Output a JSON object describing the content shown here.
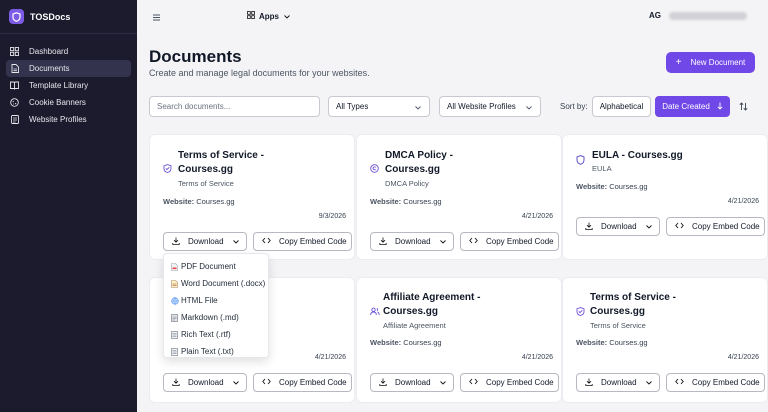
{
  "app": {
    "name": "TOSDocs"
  },
  "sidebar": {
    "items": [
      {
        "label": "Dashboard",
        "icon": "grid-icon"
      },
      {
        "label": "Documents",
        "icon": "file-icon",
        "active": true
      },
      {
        "label": "Template Library",
        "icon": "book-icon"
      },
      {
        "label": "Cookie Banners",
        "icon": "cookie-icon"
      },
      {
        "label": "Website Profiles",
        "icon": "website-icon"
      }
    ]
  },
  "topbar": {
    "apps_label": "Apps",
    "user_initials": "AG"
  },
  "page": {
    "title": "Documents",
    "subtitle": "Create and manage legal documents for your websites.",
    "new_button": "New Document"
  },
  "filters": {
    "search_placeholder": "Search documents...",
    "type_select": "All Types",
    "profile_select": "All Website Profiles",
    "sort_label": "Sort by:",
    "sort_alpha": "Alphabetical",
    "sort_date": "Date Created"
  },
  "labels": {
    "website": "Website:",
    "download": "Download",
    "copy_embed": "Copy Embed Code"
  },
  "cards": [
    {
      "title": "Terms of Service - Courses.gg",
      "type": "Terms of Service",
      "website": "Courses.gg",
      "date": "9/3/2026",
      "icon": "shield-check-icon"
    },
    {
      "title": "DMCA Policy - Courses.gg",
      "type": "DMCA Policy",
      "website": "Courses.gg",
      "date": "4/21/2026",
      "icon": "copyright-icon"
    },
    {
      "title": "EULA - Courses.gg",
      "type": "EULA",
      "website": "Courses.gg",
      "date": "4/21/2026",
      "icon": "shield-icon"
    },
    {
      "title": "",
      "type": "",
      "website": "",
      "date": "4/21/2026",
      "icon": ""
    },
    {
      "title": "Affiliate Agreement - Courses.gg",
      "type": "Affiliate Agreement",
      "website": "Courses.gg",
      "date": "4/21/2026",
      "icon": "users-icon"
    },
    {
      "title": "Terms of Service - Courses.gg",
      "type": "Terms of Service",
      "website": "Courses.gg",
      "date": "4/21/2026",
      "icon": "shield-check-icon"
    }
  ],
  "download_menu": {
    "items": [
      {
        "label": "PDF Document",
        "icon": "pdf-file-icon"
      },
      {
        "label": "Word Document (.docx)",
        "icon": "word-file-icon"
      },
      {
        "label": "HTML File",
        "icon": "globe-icon"
      },
      {
        "label": "Markdown (.md)",
        "icon": "markdown-file-icon"
      },
      {
        "label": "Rich Text (.rtf)",
        "icon": "text-file-icon"
      },
      {
        "label": "Plain Text (.txt)",
        "icon": "text-file-icon"
      }
    ]
  },
  "colors": {
    "accent": "#7048e8",
    "sidebar": "#1c1b2e"
  }
}
